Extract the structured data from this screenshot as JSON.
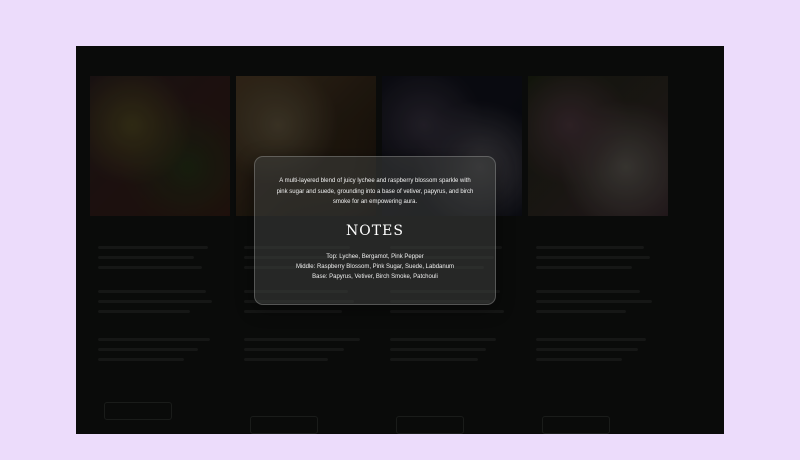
{
  "page": {
    "header": ""
  },
  "cards": [
    {
      "tag": "",
      "title": "",
      "button_label": "",
      "gradient": [
        "#6b4a4a",
        "#c7b04a",
        "#5f7a35",
        "#8a3c2f"
      ]
    },
    {
      "tag": "",
      "title": "",
      "button_label": "",
      "gradient": [
        "#c49255",
        "#f0cf8f",
        "#7c5a33",
        "#3e2b1a"
      ]
    },
    {
      "tag": "",
      "title": "",
      "button_label": "",
      "gradient": [
        "#2c2f4a",
        "#8a7ca0",
        "#d8d0e3",
        "#1f2440"
      ]
    },
    {
      "tag": "",
      "title": "",
      "button_label": "",
      "gradient": [
        "#4c5a2e",
        "#c1879a",
        "#e5d9c7",
        "#8a5b6a"
      ]
    }
  ],
  "modal": {
    "description": "A multi-layered blend of juicy lychee and raspberry blossom sparkle with pink sugar and suede, grounding into a base of vetiver, papyrus, and birch smoke for an empowering aura.",
    "heading": "NOTES",
    "notes": {
      "top": "Top: Lychee, Bergamot, Pink Pepper",
      "middle": "Middle: Raspberry Blossom, Pink Sugar, Suede, Labdanum",
      "base": "Base: Papyrus, Vetiver, Birch Smoke, Patchouli"
    }
  },
  "colors": {
    "page_background": "#ecdcfb",
    "frame_background": "#0c0d0c",
    "modal_text": "#ffffff"
  }
}
